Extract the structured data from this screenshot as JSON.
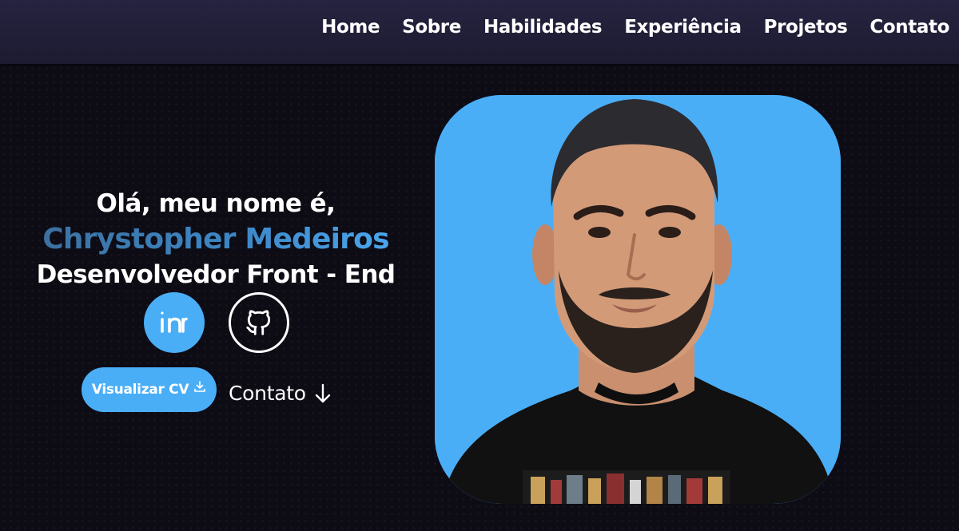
{
  "nav": {
    "items": [
      {
        "label": "Home"
      },
      {
        "label": "Sobre"
      },
      {
        "label": "Habilidades"
      },
      {
        "label": "Experiência"
      },
      {
        "label": "Projetos"
      },
      {
        "label": "Contato"
      }
    ]
  },
  "hero": {
    "greeting": "Olá, meu nome é,",
    "name": "Chrystopher Medeiros",
    "role": "Desenvolvedor Front - End",
    "cv_button_label": "Visualizar CV",
    "contact_label": "Contato",
    "social": [
      {
        "icon": "linkedin-icon"
      },
      {
        "icon": "github-icon"
      }
    ],
    "photo_background": "#4aaef7"
  },
  "colors": {
    "accent": "#4aaef7",
    "background": "#0d0c15",
    "header": "#262340"
  }
}
